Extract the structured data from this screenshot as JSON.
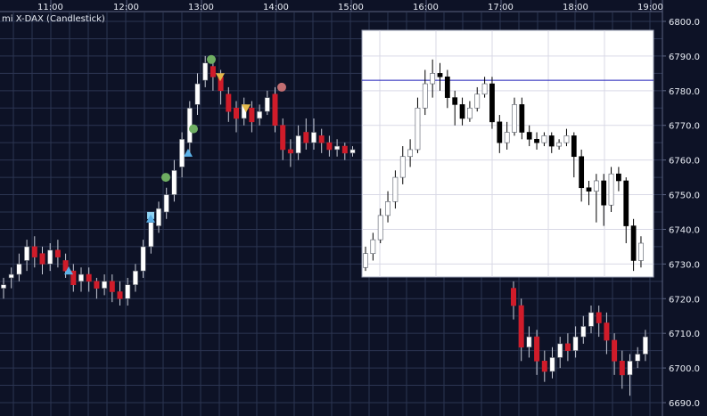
{
  "chart_data": [
    {
      "type": "candlestick",
      "title": "mi X-DAX (Candlestick)",
      "x_ticks": [
        "11:00",
        "12:00",
        "13:00",
        "14:00",
        "15:00",
        "16:00",
        "17:00",
        "18:00",
        "19:00"
      ],
      "y_ticks": [
        "6690.0",
        "6700.0",
        "6710.0",
        "6720.0",
        "6730.0",
        "6740.0",
        "6750.0",
        "6760.0",
        "6770.0",
        "6780.0",
        "6790.0",
        "6800.0"
      ],
      "ylim": [
        6687,
        6802
      ],
      "grid": true,
      "colors": {
        "background": "#0d1226",
        "grid": "#2c3552",
        "up": "#ffffff",
        "down": "#d01c2a",
        "wick": "#c8ccd8"
      },
      "candles": [
        [
          6723,
          6724,
          6720,
          6726
        ],
        [
          6726,
          6727,
          6723,
          6729
        ],
        [
          6727,
          6730,
          6725,
          6733
        ],
        [
          6731,
          6735,
          6728,
          6737
        ],
        [
          6735,
          6732,
          6729,
          6738
        ],
        [
          6733,
          6730,
          6727,
          6735
        ],
        [
          6730,
          6734,
          6728,
          6736
        ],
        [
          6734,
          6732,
          6729,
          6737
        ],
        [
          6731,
          6728,
          6726,
          6733
        ],
        [
          6728,
          6724,
          6722,
          6730
        ],
        [
          6725,
          6727,
          6722,
          6729
        ],
        [
          6727,
          6725,
          6722,
          6729
        ],
        [
          6725,
          6723,
          6720,
          6726
        ],
        [
          6723,
          6725,
          6721,
          6727
        ],
        [
          6725,
          6722,
          6719,
          6727
        ],
        [
          6722,
          6720,
          6718,
          6725
        ],
        [
          6720,
          6724,
          6718,
          6726
        ],
        [
          6724,
          6728,
          6722,
          6730
        ],
        [
          6728,
          6735,
          6726,
          6737
        ],
        [
          6735,
          6742,
          6733,
          6745
        ],
        [
          6741,
          6746,
          6739,
          6748
        ],
        [
          6745,
          6750,
          6743,
          6752
        ],
        [
          6750,
          6757,
          6748,
          6760
        ],
        [
          6758,
          6766,
          6755,
          6768
        ],
        [
          6765,
          6775,
          6762,
          6777
        ],
        [
          6776,
          6782,
          6773,
          6785
        ],
        [
          6783,
          6788,
          6781,
          6790
        ],
        [
          6787,
          6784,
          6780,
          6789
        ],
        [
          6784,
          6780,
          6776,
          6786
        ],
        [
          6779,
          6774,
          6771,
          6781
        ],
        [
          6775,
          6772,
          6768,
          6777
        ],
        [
          6772,
          6776,
          6770,
          6778
        ],
        [
          6775,
          6771,
          6768,
          6777
        ],
        [
          6772,
          6774,
          6770,
          6776
        ],
        [
          6774,
          6778,
          6773,
          6780
        ],
        [
          6779,
          6770,
          6768,
          6781
        ],
        [
          6770,
          6763,
          6760,
          6772
        ],
        [
          6763,
          6762,
          6758,
          6766
        ],
        [
          6762,
          6767,
          6760,
          6770
        ],
        [
          6768,
          6765,
          6763,
          6772
        ],
        [
          6765,
          6768,
          6763,
          6772
        ],
        [
          6767,
          6765,
          6762,
          6769
        ],
        [
          6765,
          6763,
          6761,
          6767
        ],
        [
          6763,
          6764,
          6761,
          6766
        ],
        [
          6764,
          6762,
          6760,
          6765
        ],
        [
          6762,
          6763,
          6761,
          6764
        ],
        [
          6729,
          6733,
          6728,
          6735
        ],
        [
          6733,
          6737,
          6731,
          6739
        ],
        [
          6737,
          6744,
          6736,
          6746
        ],
        [
          6744,
          6748,
          6742,
          6751
        ],
        [
          6748,
          6755,
          6746,
          6757
        ],
        [
          6755,
          6761,
          6753,
          6764
        ],
        [
          6761,
          6763,
          6758,
          6766
        ],
        [
          6763,
          6775,
          6762,
          6778
        ],
        [
          6775,
          6782,
          6773,
          6786
        ],
        [
          6782,
          6785,
          6778,
          6789
        ],
        [
          6785,
          6784,
          6780,
          6788
        ],
        [
          6784,
          6778,
          6775,
          6786
        ],
        [
          6778,
          6776,
          6770,
          6780
        ],
        [
          6776,
          6772,
          6770,
          6778
        ],
        [
          6772,
          6775,
          6771,
          6777
        ],
        [
          6775,
          6779,
          6774,
          6781
        ],
        [
          6779,
          6782,
          6778,
          6784
        ],
        [
          6782,
          6771,
          6769,
          6784
        ],
        [
          6771,
          6765,
          6762,
          6773
        ],
        [
          6765,
          6768,
          6763,
          6771
        ],
        [
          6768,
          6776,
          6767,
          6778
        ],
        [
          6776,
          6768,
          6766,
          6778
        ],
        [
          6768,
          6766,
          6764,
          6770
        ],
        [
          6766,
          6765,
          6763,
          6768
        ],
        [
          6765,
          6767,
          6764,
          6768
        ],
        [
          6767,
          6764,
          6762,
          6768
        ],
        [
          6764,
          6765,
          6763,
          6766
        ],
        [
          6765,
          6767,
          6764,
          6769
        ],
        [
          6767,
          6761,
          6755,
          6768
        ],
        [
          6761,
          6752,
          6748,
          6763
        ],
        [
          6752,
          6751,
          6747,
          6754
        ],
        [
          6751,
          6754,
          6742,
          6756
        ],
        [
          6754,
          6747,
          6741,
          6756
        ],
        [
          6747,
          6756,
          6745,
          6758
        ],
        [
          6756,
          6754,
          6751,
          6758
        ],
        [
          6754,
          6741,
          6736,
          6755
        ],
        [
          6741,
          6731,
          6728,
          6743
        ],
        [
          6731,
          6736,
          6729,
          6738
        ],
        [
          6723,
          6718,
          6714,
          6725
        ],
        [
          6718,
          6706,
          6702,
          6720
        ],
        [
          6706,
          6709,
          6703,
          6712
        ],
        [
          6709,
          6702,
          6698,
          6711
        ],
        [
          6702,
          6699,
          6696,
          6705
        ],
        [
          6699,
          6703,
          6697,
          6706
        ],
        [
          6703,
          6707,
          6700,
          6709
        ],
        [
          6707,
          6705,
          6702,
          6710
        ],
        [
          6705,
          6709,
          6703,
          6712
        ],
        [
          6709,
          6712,
          6707,
          6715
        ],
        [
          6712,
          6716,
          6710,
          6718
        ],
        [
          6716,
          6713,
          6709,
          6718
        ],
        [
          6713,
          6708,
          6704,
          6716
        ],
        [
          6708,
          6702,
          6698,
          6710
        ],
        [
          6702,
          6698,
          6694,
          6705
        ],
        [
          6698,
          6702,
          6692,
          6704
        ],
        [
          6702,
          6704,
          6700,
          6706
        ],
        [
          6704,
          6709,
          6702,
          6711
        ]
      ],
      "markers": [
        {
          "shape": "triangle-up",
          "color": "#5cb0e6",
          "value": 6728
        },
        {
          "shape": "square",
          "color": "#8fd3f2",
          "value": 6744
        },
        {
          "shape": "triangle-up",
          "color": "#5cb0e6",
          "value": 6743
        },
        {
          "shape": "circle",
          "color": "#6fae62",
          "value": 6755
        },
        {
          "shape": "triangle-up",
          "color": "#5cb0e6",
          "value": 6762
        },
        {
          "shape": "circle",
          "color": "#6fae62",
          "value": 6769
        },
        {
          "shape": "circle",
          "color": "#6fae62",
          "value": 6789
        },
        {
          "shape": "triangle-down",
          "color": "#e4b94a",
          "value": 6784
        },
        {
          "shape": "triangle-down",
          "color": "#e4b94a",
          "value": 6775
        },
        {
          "shape": "circle",
          "color": "#c26e72",
          "value": 6781
        }
      ]
    },
    {
      "type": "candlestick",
      "overlay": "inset",
      "colors": {
        "background": "#ffffff",
        "grid": "#d9d9e6",
        "up": "#ffffff",
        "down": "#000000",
        "line": "#1a1ab8"
      },
      "horizontal_line": 6783
    }
  ]
}
